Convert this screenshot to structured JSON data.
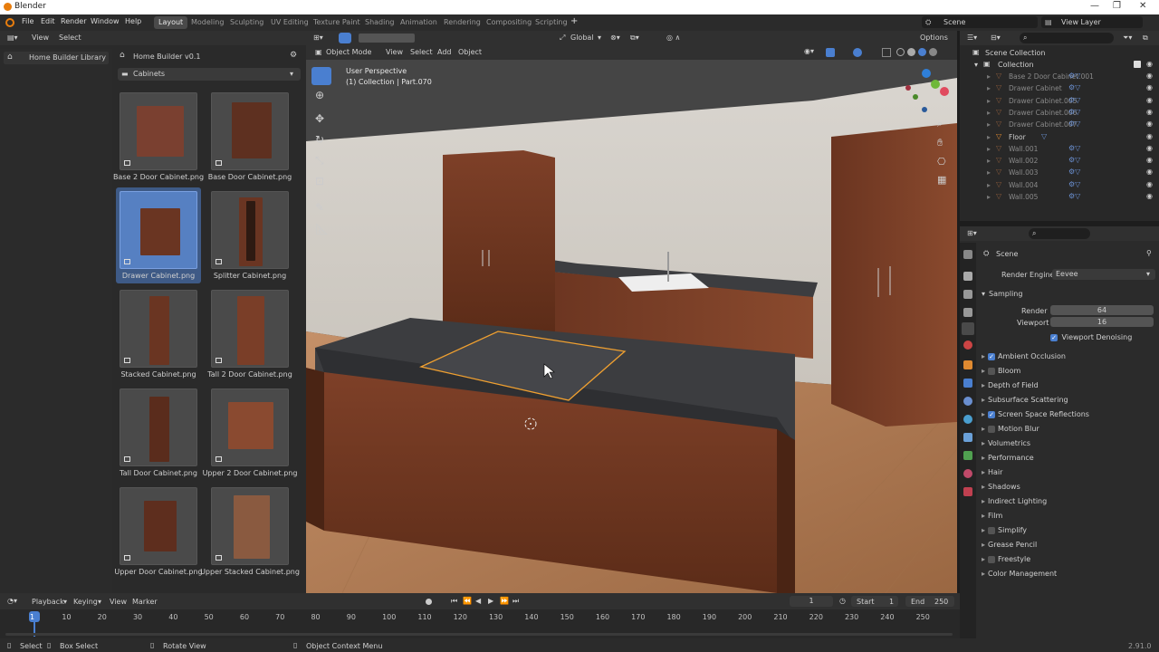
{
  "window": {
    "title": "Blender",
    "version": "2.91.0"
  },
  "menu": [
    "File",
    "Edit",
    "Render",
    "Window",
    "Help"
  ],
  "workspaces": [
    "Layout",
    "Modeling",
    "Sculpting",
    "UV Editing",
    "Texture Paint",
    "Shading",
    "Animation",
    "Rendering",
    "Compositing",
    "Scripting"
  ],
  "active_workspace": "Layout",
  "scene_field": "Scene",
  "view_layer_field": "View Layer",
  "file_browser": {
    "header_menu": [
      "View",
      "Select"
    ],
    "library": "Home Builder Library",
    "addon": "Home Builder v0.1",
    "category": "Cabinets",
    "items": [
      {
        "label": "Base 2 Door Cabinet.png",
        "selected": false
      },
      {
        "label": "Base Door Cabinet.png",
        "selected": false
      },
      {
        "label": "Drawer Cabinet.png",
        "selected": true
      },
      {
        "label": "Splitter Cabinet.png",
        "selected": false
      },
      {
        "label": "Stacked Cabinet.png",
        "selected": false
      },
      {
        "label": "Tall 2 Door Cabinet.png",
        "selected": false
      },
      {
        "label": "Tall Door Cabinet.png",
        "selected": false
      },
      {
        "label": "Upper 2 Door Cabinet.png",
        "selected": false
      },
      {
        "label": "Upper Door Cabinet.png",
        "selected": false
      },
      {
        "label": "Upper Stacked Cabinet.png",
        "selected": false
      }
    ]
  },
  "viewport": {
    "mode": "Object Mode",
    "menu": [
      "View",
      "Select",
      "Add",
      "Object"
    ],
    "transform_orientation": "Global",
    "options": "Options",
    "overlay_title": "User Perspective",
    "overlay_subtitle": "(1) Collection | Part.070"
  },
  "outliner": {
    "root": "Scene Collection",
    "collection": "Collection",
    "objects": [
      "Base 2 Door Cabinet.001",
      "Drawer Cabinet",
      "Drawer Cabinet.005",
      "Drawer Cabinet.006",
      "Drawer Cabinet.007",
      "Floor",
      "Wall.001",
      "Wall.002",
      "Wall.003",
      "Wall.004",
      "Wall.005"
    ],
    "active_object": "Floor"
  },
  "properties": {
    "context": "Scene",
    "render_engine_label": "Render Engine",
    "render_engine": "Eevee",
    "sampling": "Sampling",
    "render_label": "Render",
    "render_samples": "64",
    "viewport_label": "Viewport",
    "viewport_samples": "16",
    "viewport_denoising": "Viewport Denoising",
    "sections": [
      {
        "label": "Ambient Occlusion",
        "checkbox": true,
        "checked": true
      },
      {
        "label": "Bloom",
        "checkbox": true,
        "checked": false
      },
      {
        "label": "Depth of Field",
        "checkbox": false
      },
      {
        "label": "Subsurface Scattering",
        "checkbox": false
      },
      {
        "label": "Screen Space Reflections",
        "checkbox": true,
        "checked": true
      },
      {
        "label": "Motion Blur",
        "checkbox": true,
        "checked": false
      },
      {
        "label": "Volumetrics",
        "checkbox": false
      },
      {
        "label": "Performance",
        "checkbox": false
      },
      {
        "label": "Hair",
        "checkbox": false
      },
      {
        "label": "Shadows",
        "checkbox": false
      },
      {
        "label": "Indirect Lighting",
        "checkbox": false
      },
      {
        "label": "Film",
        "checkbox": false
      },
      {
        "label": "Simplify",
        "checkbox": true,
        "checked": false
      },
      {
        "label": "Grease Pencil",
        "checkbox": false
      },
      {
        "label": "Freestyle",
        "checkbox": true,
        "checked": false
      },
      {
        "label": "Color Management",
        "checkbox": false
      }
    ]
  },
  "timeline": {
    "menu": [
      "Playback",
      "Keying",
      "View",
      "Marker"
    ],
    "current_frame": "1",
    "start_label": "Start",
    "start": "1",
    "end_label": "End",
    "end": "250",
    "ticks": [
      "1",
      "10",
      "20",
      "30",
      "40",
      "50",
      "60",
      "70",
      "80",
      "90",
      "100",
      "110",
      "120",
      "130",
      "140",
      "150",
      "160",
      "170",
      "180",
      "190",
      "200",
      "210",
      "220",
      "230",
      "240",
      "250"
    ]
  },
  "status_bar": {
    "select": "Select",
    "box_select": "Box Select",
    "rotate_view": "Rotate View",
    "context_menu": "Object Context Menu"
  },
  "colors": {
    "accent": "#4a7fd0",
    "selection_outline": "#f0a030",
    "wood": "#7a3e26",
    "countertop": "#3c3d40",
    "floor": "#b07a50"
  }
}
